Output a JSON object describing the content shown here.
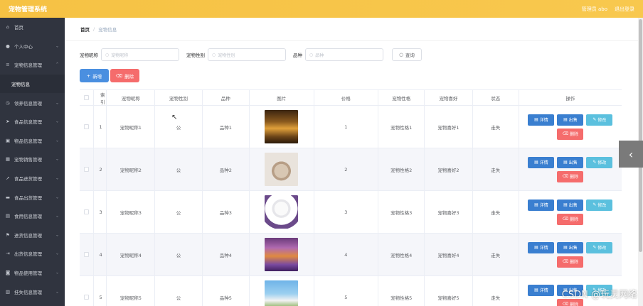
{
  "app": {
    "title": "宠物管理系统"
  },
  "topbar": {
    "user_label": "管理员 abo",
    "logout_label": "退出登录"
  },
  "sidebar": {
    "items": [
      {
        "label": "首页",
        "icon": "home-icon"
      },
      {
        "label": "个人中心",
        "icon": "user-icon"
      },
      {
        "label": "宠物信息管理",
        "icon": "list-icon"
      },
      {
        "label": "宠物信息",
        "icon": "",
        "sub": true
      },
      {
        "label": "领养信息管理",
        "icon": "clock-icon"
      },
      {
        "label": "食品信息管理",
        "icon": "send-icon"
      },
      {
        "label": "物品信息管理",
        "icon": "box-icon"
      },
      {
        "label": "宠物销售管理",
        "icon": "grid-icon"
      },
      {
        "label": "食品进货管理",
        "icon": "arrow-icon"
      },
      {
        "label": "食品出货管理",
        "icon": "truck-icon"
      },
      {
        "label": "食用信息管理",
        "icon": "doc-icon"
      },
      {
        "label": "进货信息管理",
        "icon": "flag-icon"
      },
      {
        "label": "出货信息管理",
        "icon": "out-icon"
      },
      {
        "label": "物品使用管理",
        "icon": "bag-icon"
      },
      {
        "label": "挂失信息管理",
        "icon": "alert-icon"
      }
    ]
  },
  "breadcrumb": {
    "home": "首页",
    "separator": "/",
    "current": "宠物信息"
  },
  "search": {
    "name_label": "宠物昵称",
    "name_placeholder": "宠物昵称",
    "sex_label": "宠物性别",
    "sex_placeholder": "宠物性别",
    "breed_label": "品种",
    "breed_placeholder": "品种",
    "query_label": "查询"
  },
  "actions": {
    "add_label": "新增",
    "delete_label": "删除"
  },
  "table": {
    "headers": [
      "索引",
      "宠物昵称",
      "宠物性别",
      "品种",
      "图片",
      "价格",
      "宠物性格",
      "宠物喜好",
      "状态",
      "操作"
    ],
    "ops": {
      "detail": "详情",
      "out": "出售",
      "edit": "修改",
      "del": "删除"
    },
    "rows": [
      {
        "index": "1",
        "name": "宠物昵称1",
        "sex": "公",
        "breed": "品种1",
        "price": "1",
        "character": "宠物性格1",
        "hobby": "宠物喜好1",
        "status": "走失"
      },
      {
        "index": "2",
        "name": "宠物昵称2",
        "sex": "公",
        "breed": "品种2",
        "price": "2",
        "character": "宠物性格2",
        "hobby": "宠物喜好2",
        "status": "走失"
      },
      {
        "index": "3",
        "name": "宠物昵称3",
        "sex": "公",
        "breed": "品种3",
        "price": "3",
        "character": "宠物性格3",
        "hobby": "宠物喜好3",
        "status": "走失"
      },
      {
        "index": "4",
        "name": "宠物昵称4",
        "sex": "公",
        "breed": "品种4",
        "price": "4",
        "character": "宠物性格4",
        "hobby": "宠物喜好4",
        "status": "走失"
      },
      {
        "index": "5",
        "name": "宠物昵称5",
        "sex": "公",
        "breed": "品种5",
        "price": "5",
        "character": "宠物性格5",
        "hobby": "宠物喜好5",
        "status": "走失"
      }
    ]
  },
  "watermark": "CSDN @玩灵网络"
}
